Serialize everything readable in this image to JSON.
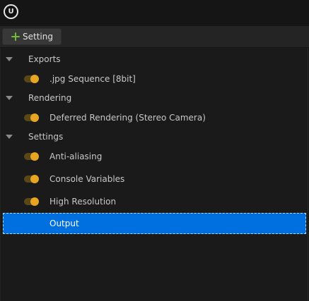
{
  "app": {
    "logo_text": "U"
  },
  "toolbar": {
    "add_setting_label": "Setting"
  },
  "tree": {
    "categories": [
      {
        "label": "Exports"
      },
      {
        "label": "Rendering"
      },
      {
        "label": "Settings"
      }
    ],
    "items": [
      {
        "label": ".jpg Sequence [8bit]",
        "enabled": true
      },
      {
        "label": "Deferred Rendering (Stereo Camera)",
        "enabled": true
      },
      {
        "label": "Anti-aliasing",
        "enabled": true
      },
      {
        "label": "Console Variables",
        "enabled": true
      },
      {
        "label": "High Resolution",
        "enabled": true
      },
      {
        "label": "Output",
        "selected": true
      }
    ]
  },
  "colors": {
    "accent_selection": "#0070e0",
    "toggle_on": "#e6a623",
    "add_icon": "#6fbb3a"
  }
}
